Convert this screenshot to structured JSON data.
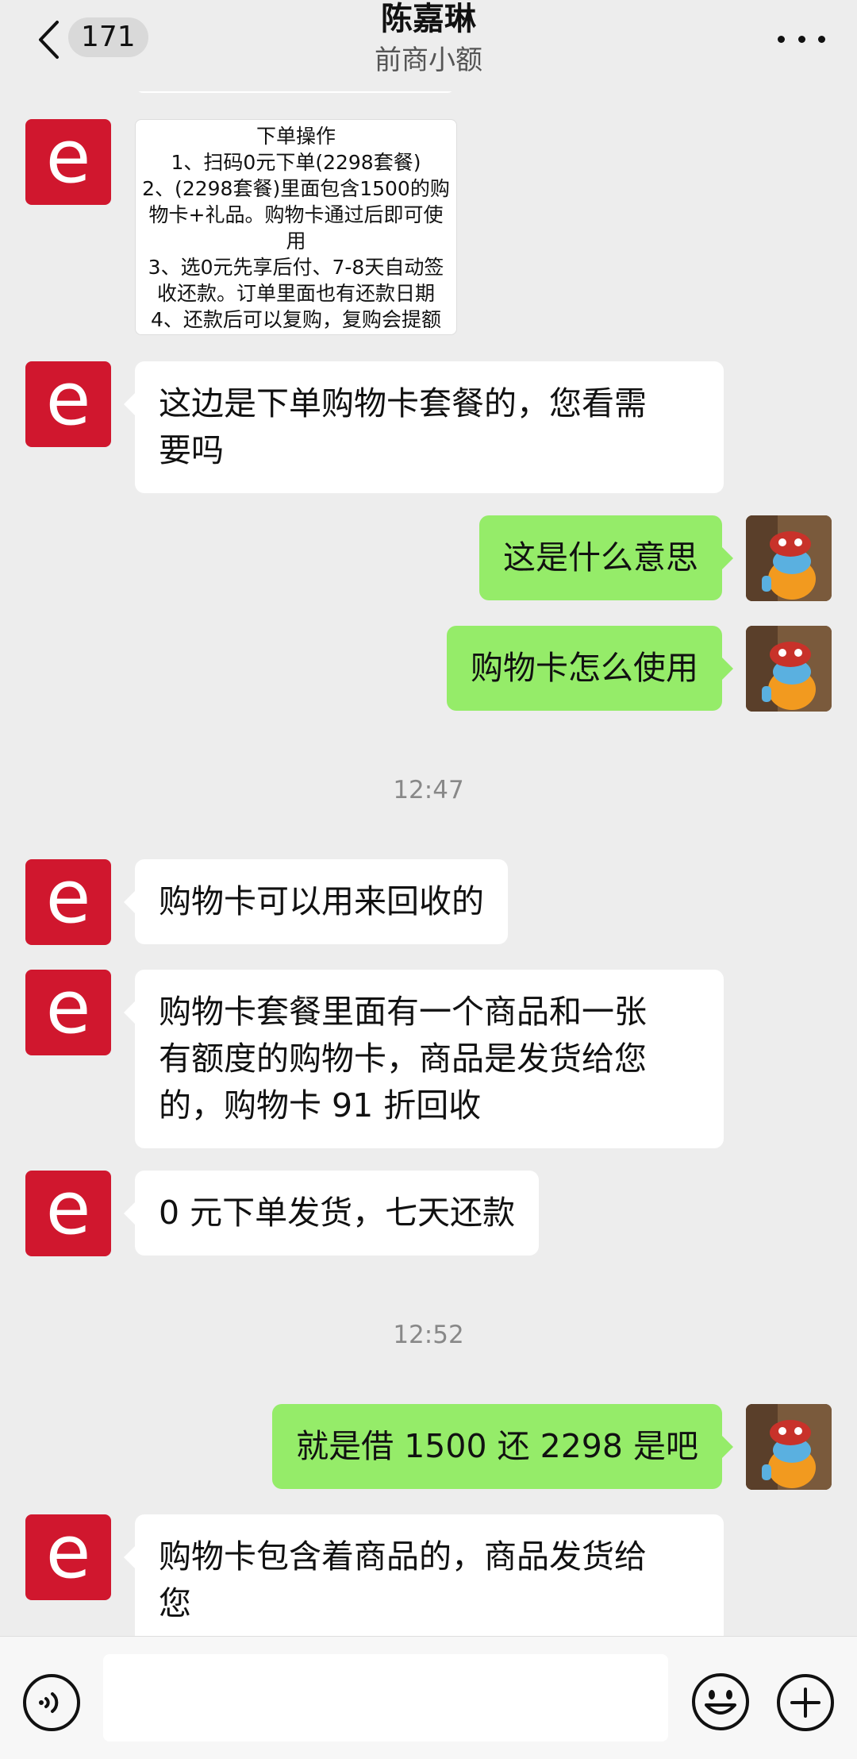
{
  "header": {
    "back_count": "171",
    "title": "陈嘉琳",
    "subtitle": "前商小额"
  },
  "avatar_letter": "e",
  "image_card": {
    "lines": [
      "下单操作",
      "1、扫码0元下单(2298套餐)",
      "2、(2298套餐)里面包含1500的购",
      "物卡+礼品。购物卡通过后即可使",
      "用",
      "3、选0元先享后付、7-8天自动签",
      "收还款。订单里面也有还款日期",
      "4、还款后可以复购，复购会提额"
    ]
  },
  "messages": [
    {
      "side": "left",
      "lines": [
        "这边是下单购物卡套餐的，您看需",
        "要吗"
      ]
    },
    {
      "side": "right",
      "lines": [
        "这是什么意思"
      ]
    },
    {
      "side": "right",
      "lines": [
        "购物卡怎么使用"
      ]
    },
    {
      "side": "left",
      "lines": [
        "购物卡可以用来回收的"
      ]
    },
    {
      "side": "left",
      "lines": [
        "购物卡套餐里面有一个商品和一张",
        "有额度的购物卡，商品是发货给您",
        "的，购物卡 91 折回收"
      ]
    },
    {
      "side": "left",
      "lines": [
        "0 元下单发货，七天还款"
      ]
    },
    {
      "side": "right",
      "lines": [
        "就是借 1500 还 2298 是吧"
      ]
    },
    {
      "side": "left",
      "lines": [
        "购物卡包含着商品的，商品发货给",
        "您"
      ]
    }
  ],
  "timestamps": [
    "12:47",
    "12:52"
  ],
  "colors": {
    "background": "#ededed",
    "bubble_me": "#95ec69",
    "bubble_other": "#ffffff",
    "avatar_brand": "#d0172e"
  },
  "icons": {
    "back": "chevron-left-icon",
    "more": "more-dots-icon",
    "voice": "voice-icon",
    "emoji": "emoji-icon",
    "plus": "plus-icon"
  }
}
